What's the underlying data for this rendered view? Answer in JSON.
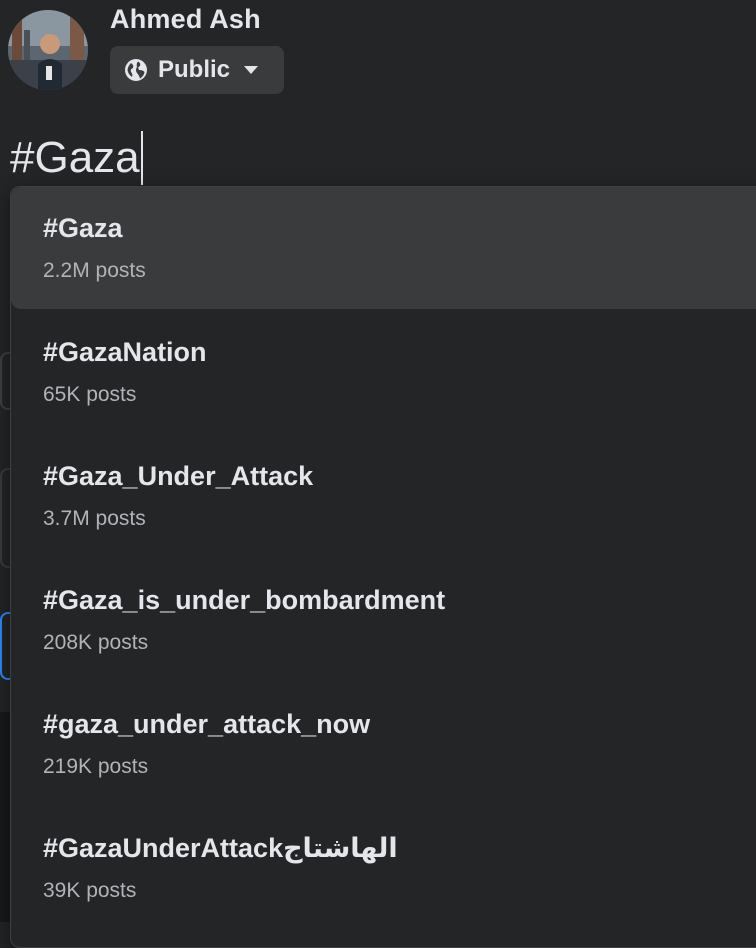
{
  "composer": {
    "user_name": "Ahmed Ash",
    "privacy_label": "Public",
    "post_text": "#Gaza"
  },
  "suggestions": [
    {
      "tag": "#Gaza",
      "count": "2.2M posts"
    },
    {
      "tag": "#GazaNation",
      "count": "65K posts"
    },
    {
      "tag": "#Gaza_Under_Attack",
      "count": "3.7M posts"
    },
    {
      "tag": "#Gaza_is_under_bombardment",
      "count": "208K posts"
    },
    {
      "tag": "#gaza_under_attack_now",
      "count": "219K posts"
    },
    {
      "tag": "#GazaUnderAttackالهاشتاج",
      "count": "39K posts"
    }
  ],
  "colors": {
    "background": "#242526",
    "highlight": "#3a3b3c",
    "primary_text": "#e4e6eb",
    "secondary_text": "#b0b3b8"
  }
}
